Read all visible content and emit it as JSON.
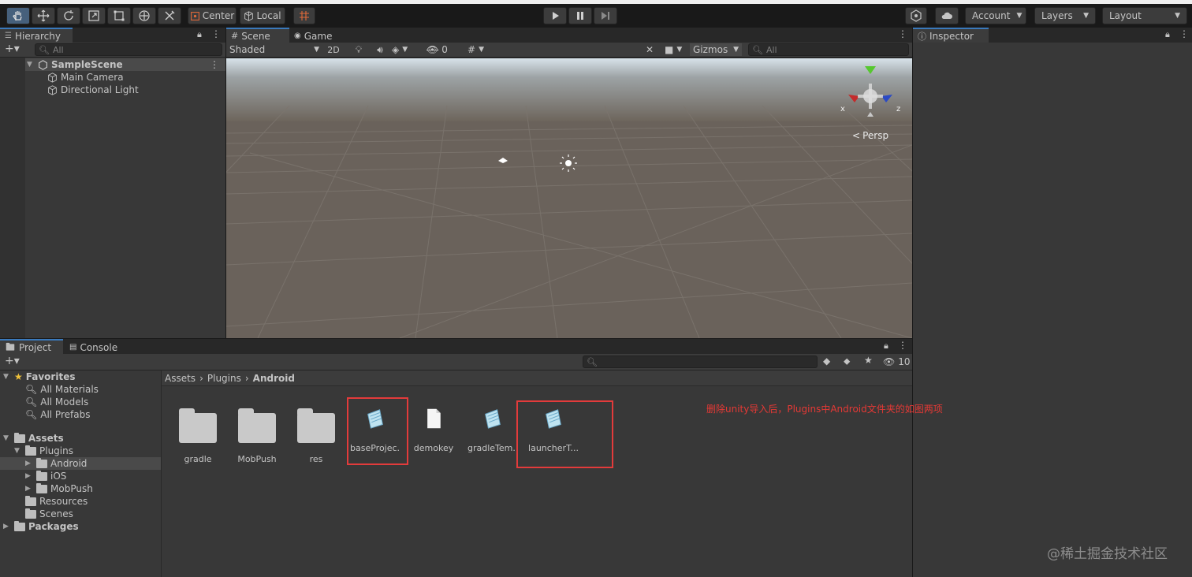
{
  "toolbar": {
    "pivot_label": "Center",
    "space_label": "Local",
    "account_label": "Account",
    "layers_label": "Layers",
    "layout_label": "Layout"
  },
  "hierarchy": {
    "tab_label": "Hierarchy",
    "search_placeholder": "All",
    "scene_name": "SampleScene",
    "items": [
      "Main Camera",
      "Directional Light"
    ]
  },
  "scene_view": {
    "tabs": [
      "Scene",
      "Game"
    ],
    "shading_mode": "Shaded",
    "mode_2d": "2D",
    "hidden_count": "0",
    "gizmos_label": "Gizmos",
    "search_placeholder": "All",
    "projection_label": "Persp",
    "axis_labels": {
      "x": "x",
      "z": "z"
    }
  },
  "inspector": {
    "tab_label": "Inspector"
  },
  "project": {
    "tabs": [
      "Project",
      "Console"
    ],
    "hidden_count": "10",
    "favorites_label": "Favorites",
    "favorites": [
      "All Materials",
      "All Models",
      "All Prefabs"
    ],
    "assets_label": "Assets",
    "tree": {
      "plugins": "Plugins",
      "android": "Android",
      "ios": "iOS",
      "mobpush": "MobPush",
      "resources": "Resources",
      "scenes": "Scenes",
      "packages": "Packages"
    },
    "breadcrumb": [
      "Assets",
      "Plugins",
      "Android"
    ],
    "files": [
      {
        "name": "gradle",
        "kind": "folder"
      },
      {
        "name": "MobPush",
        "kind": "folder"
      },
      {
        "name": "res",
        "kind": "folder"
      },
      {
        "name": "baseProjec...",
        "kind": "text-asset"
      },
      {
        "name": "demokey",
        "kind": "file"
      },
      {
        "name": "gradleTem...",
        "kind": "text-asset"
      },
      {
        "name": "launcherT...",
        "kind": "text-asset"
      }
    ]
  },
  "annotation": "删除unity导入后，Plugins中Android文件夹的如图两项",
  "watermark": "@稀土掘金技术社区",
  "colors": {
    "annotation_red": "#e33b3b",
    "selection_blue": "#3a79bb",
    "panel_dark": "#383838",
    "toolbar_bg": "#191919"
  }
}
